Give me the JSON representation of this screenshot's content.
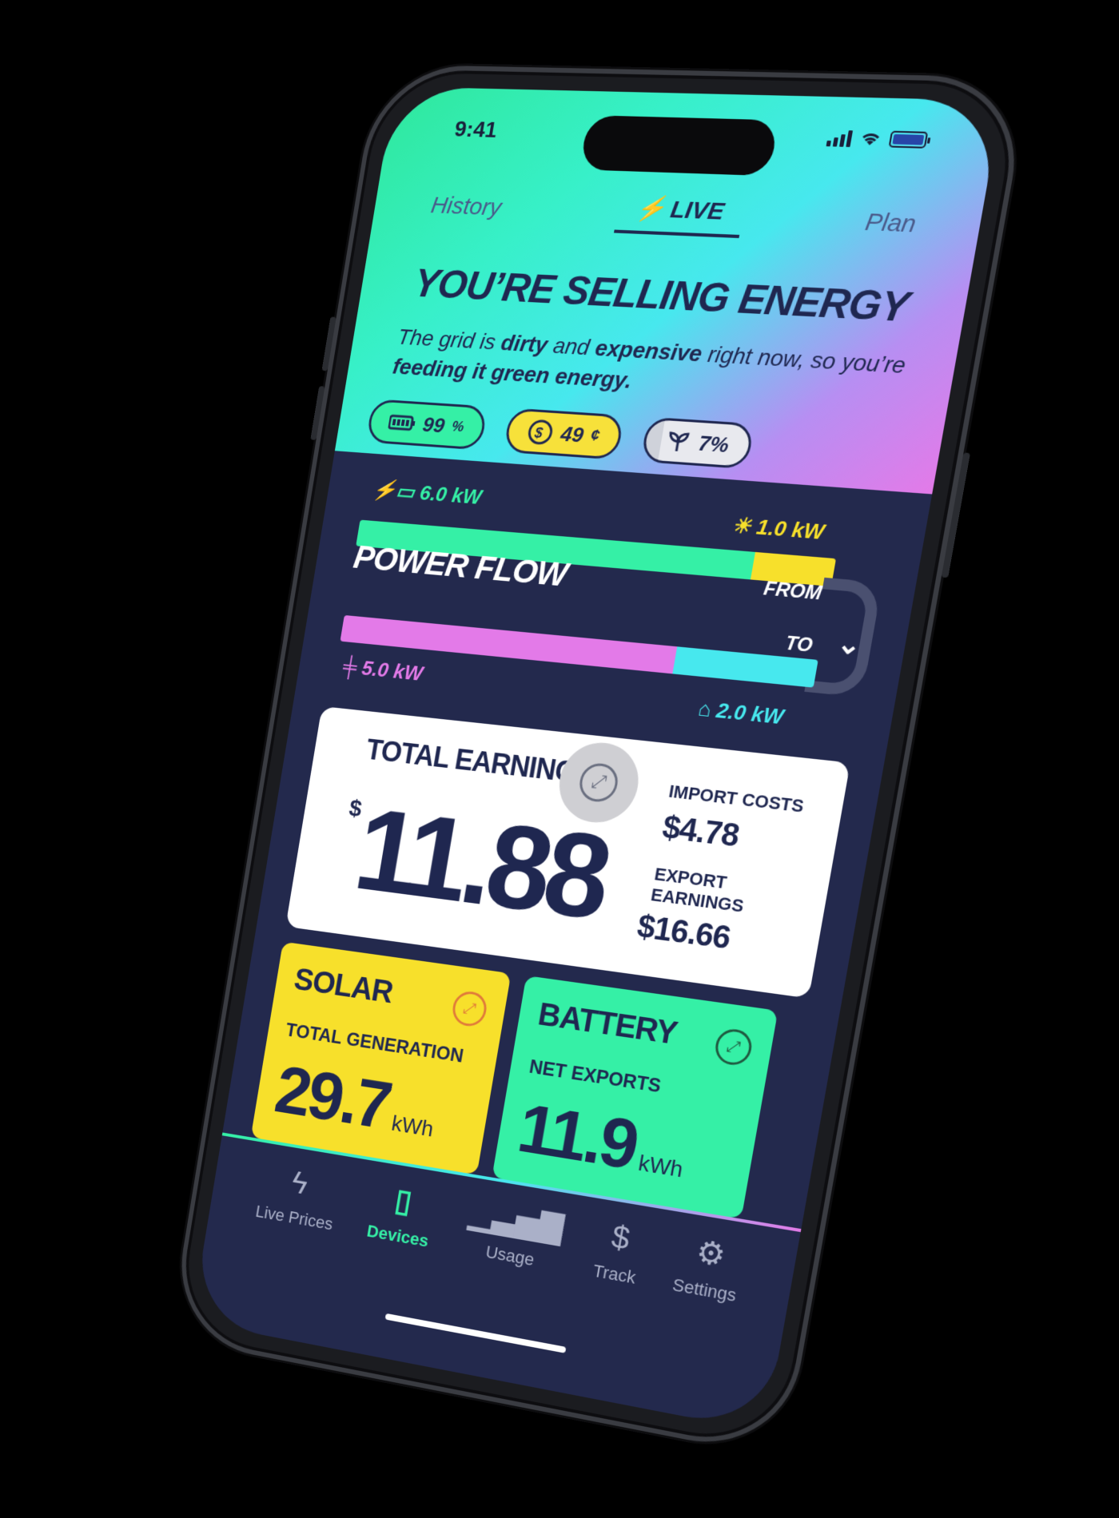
{
  "status_bar": {
    "time": "9:41"
  },
  "tabs": [
    {
      "label": "History"
    },
    {
      "label": "LIVE"
    },
    {
      "label": "Plan"
    }
  ],
  "headline": "YOU’RE SELLING ENERGY",
  "subtext": {
    "part1": "The grid is ",
    "dirty": "dirty",
    "part2": " and ",
    "expensive": "expensive",
    "part3": " right now, so you’re ",
    "feeding": "feeding it green energy."
  },
  "chips": {
    "battery": {
      "value": "99",
      "unit": "%"
    },
    "price": {
      "value": "49",
      "unit": "¢"
    },
    "green": {
      "value": "7%"
    }
  },
  "power_flow": {
    "title": "POWER FLOW",
    "from_label": "FROM",
    "to_label": "TO",
    "battery_kw": "6.0",
    "solar_kw": "1.0",
    "grid_kw": "5.0",
    "home_kw": "2.0",
    "unit": "kW"
  },
  "earnings": {
    "title": "TOTAL EARNINGS",
    "currency": "$",
    "total": "11.88",
    "import_label": "IMPORT COSTS",
    "import_value": "$4.78",
    "export_label_1": "EXPORT",
    "export_label_2": "EARNINGS",
    "export_value": "$16.66"
  },
  "solar_card": {
    "title": "SOLAR",
    "subtitle": "TOTAL GENERATION",
    "value": "29.7",
    "unit": "kWh"
  },
  "battery_card": {
    "title": "BATTERY",
    "subtitle": "NET EXPORTS",
    "value": "11.9",
    "unit": "kWh"
  },
  "tabbar": [
    {
      "label": "Live Prices",
      "icon": "bolt-icon"
    },
    {
      "label": "Devices",
      "icon": "battery-device-icon"
    },
    {
      "label": "Usage",
      "icon": "bar-chart-icon"
    },
    {
      "label": "Track",
      "icon": "dollar-search-icon"
    },
    {
      "label": "Settings",
      "icon": "gear-icon"
    }
  ],
  "colors": {
    "navy": "#23294d",
    "green": "#35f0a6",
    "yellow": "#f7e02b",
    "pink": "#e37ae8",
    "cyan": "#47e8ee"
  }
}
